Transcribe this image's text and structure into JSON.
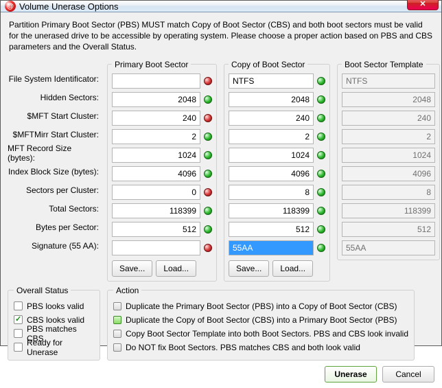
{
  "title": "Volume Unerase Options",
  "intro": "Partition Primary Boot Sector (PBS) MUST match Copy of Boot Sector (CBS) and both boot sectors must be valid for the unerased drive to be accessible by operating system. Please choose a proper action based on PBS and CBS parameters and the Overall Status.",
  "legends": {
    "pbs": "Primary Boot Sector",
    "cbs": "Copy of Boot Sector",
    "tpl": "Boot Sector Template",
    "overall": "Overall Status",
    "action": "Action"
  },
  "row_labels": {
    "fsid": "File System Identificator:",
    "hidden": "Hidden Sectors:",
    "mft": "$MFT Start Cluster:",
    "mftmirr": "$MFTMirr Start Cluster:",
    "recsize": "MFT Record Size (bytes):",
    "idxblk": "Index Block Size (bytes):",
    "spc": "Sectors per Cluster:",
    "total": "Total Sectors:",
    "bps": "Bytes per Sector:",
    "sig": "Signature (55 AA):"
  },
  "pbs": {
    "fsid": "",
    "hidden": "2048",
    "mft": "240",
    "mftmirr": "2",
    "recsize": "1024",
    "idxblk": "4096",
    "spc": "0",
    "total": "118399",
    "bps": "512",
    "sig": ""
  },
  "pbs_status": {
    "fsid": "red",
    "hidden": "green",
    "mft": "red",
    "mftmirr": "green",
    "recsize": "green",
    "idxblk": "green",
    "spc": "red",
    "total": "green",
    "bps": "green",
    "sig": "red"
  },
  "cbs": {
    "fsid": "NTFS",
    "hidden": "2048",
    "mft": "240",
    "mftmirr": "2",
    "recsize": "1024",
    "idxblk": "4096",
    "spc": "8",
    "total": "118399",
    "bps": "512",
    "sig": "55AA"
  },
  "cbs_status": {
    "fsid": "green",
    "hidden": "green",
    "mft": "green",
    "mftmirr": "green",
    "recsize": "green",
    "idxblk": "green",
    "spc": "green",
    "total": "green",
    "bps": "green",
    "sig": "green"
  },
  "tpl": {
    "fsid": "NTFS",
    "hidden": "2048",
    "mft": "240",
    "mftmirr": "2",
    "recsize": "1024",
    "idxblk": "4096",
    "spc": "8",
    "total": "118399",
    "bps": "512",
    "sig": "55AA"
  },
  "buttons": {
    "save": "Save...",
    "load": "Load...",
    "unerase": "Unerase",
    "cancel": "Cancel"
  },
  "overall": {
    "pbs_valid": "PBS looks valid",
    "cbs_valid": "CBS looks valid",
    "pbs_matches": "PBS matches CBS",
    "ready": "Ready for Unerase"
  },
  "overall_checked": {
    "pbs_valid": false,
    "cbs_valid": true,
    "pbs_matches": false,
    "ready": false
  },
  "actions": {
    "a1": "Duplicate the Primary Boot Sector (PBS) into a Copy of Boot Sector (CBS)",
    "a2": "Duplicate the Copy of Boot Sector (CBS) into a Primary Boot Sector (PBS)",
    "a3": "Copy Boot Sector Template into both Boot Sectors. PBS and CBS look invalid",
    "a4": "Do NOT fix Boot Sectors. PBS matches CBS and both look valid"
  },
  "action_selected": "a2"
}
